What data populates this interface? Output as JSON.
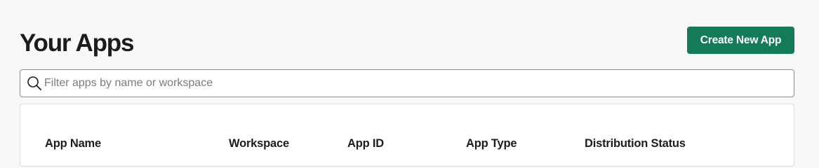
{
  "header": {
    "title": "Your Apps",
    "create_button_label": "Create New App"
  },
  "search": {
    "placeholder": "Filter apps by name or workspace",
    "value": "",
    "icon": "search-icon"
  },
  "table": {
    "columns": [
      "App Name",
      "Workspace",
      "App ID",
      "App Type",
      "Distribution Status"
    ]
  },
  "colors": {
    "accent": "#137a5a",
    "background": "#f8f8f8",
    "text": "#1d1c1d"
  }
}
